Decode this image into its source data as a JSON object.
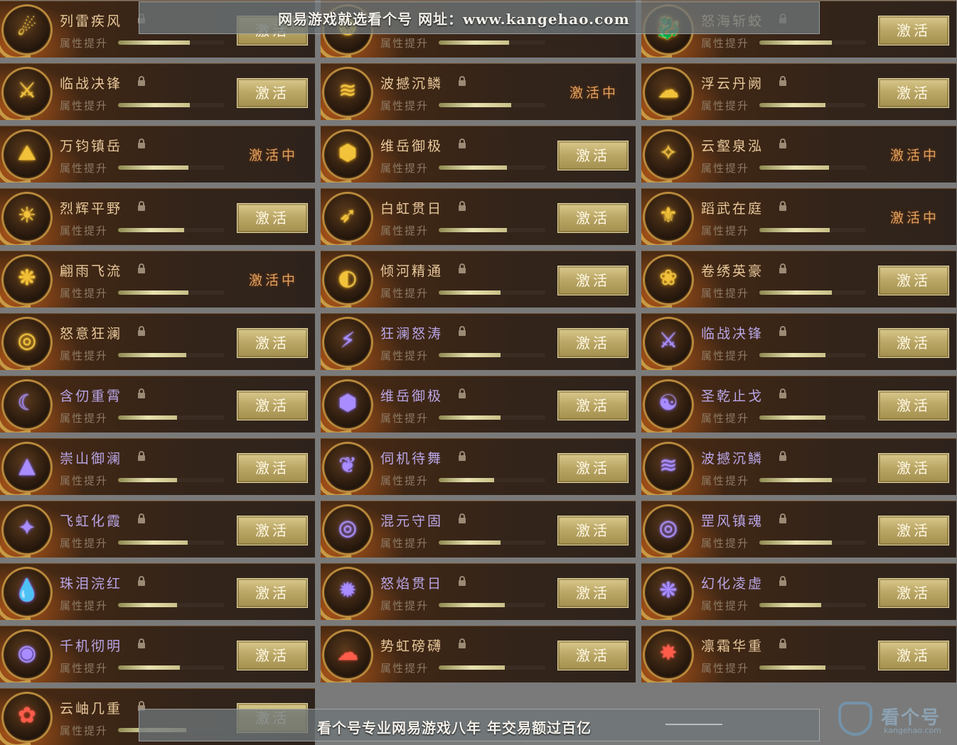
{
  "watermark": {
    "top": "网易游戏就选看个号  网址：www.kangehao.com",
    "bottom": "看个号专业网易游戏八年  年交易额过百亿",
    "logo_text": "看个号",
    "logo_sub": "kangehao.com"
  },
  "button_label": "激活",
  "attr_label": "属性提升",
  "columns": [
    [
      {
        "name": "列雷疾风",
        "theme": "gold",
        "state": "button",
        "progress": 0.67,
        "glyph": "☄"
      },
      {
        "name": "临战决锋",
        "theme": "gold",
        "state": "button",
        "progress": 0.67,
        "glyph": "⚔"
      },
      {
        "name": "万钧镇岳",
        "theme": "gold",
        "state": "active",
        "progress": 0.66,
        "glyph": "⛰"
      },
      {
        "name": "烈辉平野",
        "theme": "gold",
        "state": "button",
        "progress": 0.62,
        "glyph": "☀"
      },
      {
        "name": "翩雨飞流",
        "theme": "gold",
        "state": "active",
        "progress": 0.66,
        "glyph": "❋"
      },
      {
        "name": "怒意狂澜",
        "theme": "gold",
        "state": "button",
        "progress": 0.64,
        "glyph": "◎"
      },
      {
        "name": "含仞重霄",
        "theme": "purple",
        "state": "button",
        "progress": 0.55,
        "glyph": "☾"
      },
      {
        "name": "崇山御澜",
        "theme": "purple",
        "state": "button",
        "progress": 0.55,
        "glyph": "▲"
      },
      {
        "name": "飞虹化霞",
        "theme": "purple",
        "state": "button",
        "progress": 0.65,
        "glyph": "✦"
      },
      {
        "name": "珠泪浣红",
        "theme": "purple",
        "state": "button",
        "progress": 0.55,
        "glyph": "💧"
      },
      {
        "name": "千机彻明",
        "theme": "purple",
        "state": "button",
        "progress": 0.58,
        "glyph": "◉"
      },
      {
        "name": "云岫几重",
        "theme": "red",
        "state": "button",
        "progress": 0.64,
        "glyph": "✿"
      }
    ],
    [
      {
        "name": "",
        "theme": "gold",
        "state": "none",
        "progress": 0.66,
        "glyph": "❂"
      },
      {
        "name": "波撼沉鳞",
        "theme": "gold",
        "state": "active",
        "progress": 0.68,
        "glyph": "≋"
      },
      {
        "name": "维岳御极",
        "theme": "gold",
        "state": "button",
        "progress": 0.64,
        "glyph": "⬢"
      },
      {
        "name": "白虹贯日",
        "theme": "gold",
        "state": "button",
        "progress": 0.64,
        "glyph": "➶"
      },
      {
        "name": "倾河精通",
        "theme": "gold",
        "state": "button",
        "progress": 0.58,
        "glyph": "◐"
      },
      {
        "name": "狂澜怒涛",
        "theme": "purple",
        "state": "button",
        "progress": 0.58,
        "glyph": "⚡"
      },
      {
        "name": "维岳御极",
        "theme": "purple",
        "state": "button",
        "progress": 0.58,
        "glyph": "⬢"
      },
      {
        "name": "伺机待舞",
        "theme": "purple",
        "state": "button",
        "progress": 0.52,
        "glyph": "❦"
      },
      {
        "name": "混元守固",
        "theme": "purple",
        "state": "button",
        "progress": 0.58,
        "glyph": "◎"
      },
      {
        "name": "怒焰贯日",
        "theme": "purple",
        "state": "button",
        "progress": 0.62,
        "glyph": "✹"
      },
      {
        "name": "势虹磅礴",
        "theme": "red",
        "state": "button",
        "progress": 0.62,
        "glyph": "☁"
      }
    ],
    [
      {
        "name": "怒海斩蛟",
        "theme": "gold",
        "state": "button",
        "progress": 0.68,
        "glyph": "🐉"
      },
      {
        "name": "浮云丹阙",
        "theme": "gold",
        "state": "button",
        "progress": 0.62,
        "glyph": "☁"
      },
      {
        "name": "云壑泉泓",
        "theme": "gold",
        "state": "active",
        "progress": 0.65,
        "glyph": "✧"
      },
      {
        "name": "蹈武在庭",
        "theme": "gold",
        "state": "active",
        "progress": 0.66,
        "glyph": "⚜"
      },
      {
        "name": "卷绣英豪",
        "theme": "gold",
        "state": "button",
        "progress": 0.68,
        "glyph": "❀"
      },
      {
        "name": "临战决锋",
        "theme": "purple",
        "state": "button",
        "progress": 0.62,
        "glyph": "⚔"
      },
      {
        "name": "圣乾止戈",
        "theme": "purple",
        "state": "button",
        "progress": 0.62,
        "glyph": "☯"
      },
      {
        "name": "波撼沉鳞",
        "theme": "purple",
        "state": "button",
        "progress": 0.68,
        "glyph": "≋"
      },
      {
        "name": "罡风镇魂",
        "theme": "purple",
        "state": "button",
        "progress": 0.68,
        "glyph": "◎"
      },
      {
        "name": "幻化凌虚",
        "theme": "purple",
        "state": "button",
        "progress": 0.58,
        "glyph": "❋"
      },
      {
        "name": "凛霜华重",
        "theme": "red",
        "state": "button",
        "progress": 0.62,
        "glyph": "✸"
      }
    ]
  ],
  "active_label": "激活中"
}
